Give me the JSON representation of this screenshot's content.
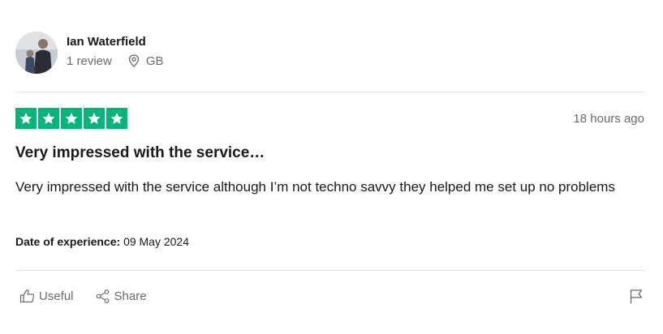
{
  "review": {
    "user": {
      "name": "Ian Waterfield",
      "reviews": "1 review",
      "country": "GB"
    },
    "rating": 5,
    "rating_color": "#00b67a",
    "time_ago": "18 hours ago",
    "title": "Very impressed with the service…",
    "text": "Very impressed with the service although I’m not techno savvy they helped me set up no problems",
    "experience_label": "Date of experience:",
    "experience_date": "09 May 2024"
  },
  "actions": {
    "useful_label": "Useful",
    "share_label": "Share"
  },
  "icons": {
    "location": "location-pin-icon",
    "star": "star-icon",
    "useful": "thumbs-up-icon",
    "share": "share-icon",
    "flag": "flag-icon"
  }
}
